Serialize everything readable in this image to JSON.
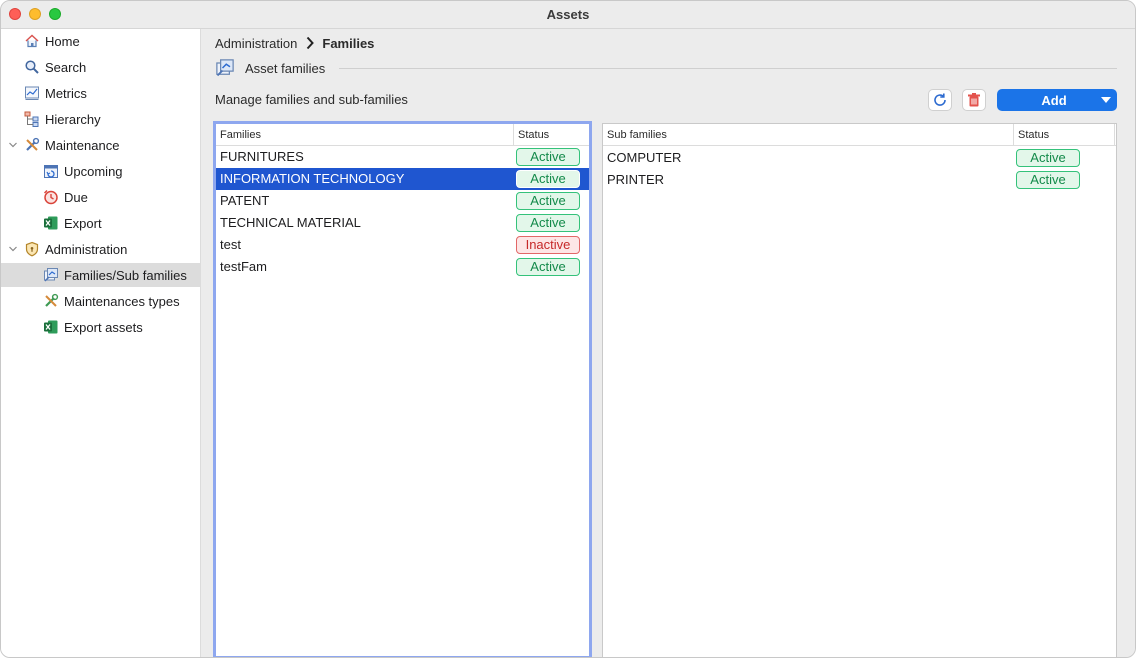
{
  "window": {
    "title": "Assets"
  },
  "sidebar": {
    "items": [
      {
        "label": "Home",
        "icon": "home-icon"
      },
      {
        "label": "Search",
        "icon": "search-icon"
      },
      {
        "label": "Metrics",
        "icon": "metrics-icon"
      },
      {
        "label": "Hierarchy",
        "icon": "hierarchy-icon"
      },
      {
        "label": "Maintenance",
        "icon": "tools-icon",
        "expanded": true
      },
      {
        "label": "Upcoming",
        "icon": "calendar-icon"
      },
      {
        "label": "Due",
        "icon": "clock-icon"
      },
      {
        "label": "Export",
        "icon": "excel-icon"
      },
      {
        "label": "Administration",
        "icon": "shield-icon",
        "expanded": true
      },
      {
        "label": "Families/Sub families",
        "icon": "families-icon",
        "selected": true
      },
      {
        "label": "Maintenances types",
        "icon": "tools-icon"
      },
      {
        "label": "Export assets",
        "icon": "excel-icon"
      }
    ]
  },
  "breadcrumb": {
    "parent": "Administration",
    "current": "Families"
  },
  "section": {
    "label": "Asset families"
  },
  "description": "Manage families and sub-families",
  "toolbar": {
    "add_label": "Add"
  },
  "families_table": {
    "headers": {
      "name": "Families",
      "status": "Status"
    },
    "rows": [
      {
        "name": "FURNITURES",
        "status": "Active"
      },
      {
        "name": "INFORMATION TECHNOLOGY",
        "status": "Active",
        "selected": true
      },
      {
        "name": "PATENT",
        "status": "Active"
      },
      {
        "name": "TECHNICAL MATERIAL",
        "status": "Active"
      },
      {
        "name": "test",
        "status": "Inactive"
      },
      {
        "name": "testFam",
        "status": "Active"
      }
    ]
  },
  "subfamilies_table": {
    "headers": {
      "name": "Sub families",
      "status": "Status"
    },
    "rows": [
      {
        "name": "COMPUTER",
        "status": "Active"
      },
      {
        "name": "PRINTER",
        "status": "Active"
      }
    ]
  },
  "colors": {
    "accent": "#1b74e8",
    "selection": "#1f56d0",
    "active_border": "#34c27a",
    "inactive_border": "#e26767"
  }
}
